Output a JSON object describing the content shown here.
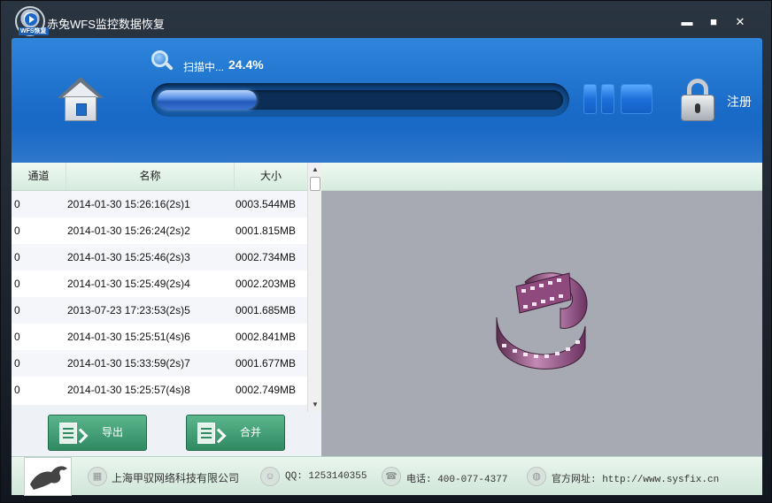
{
  "window": {
    "title": "赤兔WFS监控数据恢复",
    "logo_tag": "WFS恢复",
    "minimize": "▬",
    "maximize": "■",
    "close": "✕"
  },
  "header": {
    "scan_label": "扫描中...",
    "scan_percent": "24.4%",
    "progress": 0.244,
    "register_label": "注册"
  },
  "list": {
    "columns": [
      "通道",
      "名称",
      "大小"
    ],
    "rows": [
      {
        "channel": "0",
        "name": "2014-01-30 15:26:16(2s)1",
        "size": "0003.544MB"
      },
      {
        "channel": "0",
        "name": "2014-01-30 15:26:24(2s)2",
        "size": "0001.815MB"
      },
      {
        "channel": "0",
        "name": "2014-01-30 15:25:46(2s)3",
        "size": "0002.734MB"
      },
      {
        "channel": "0",
        "name": "2014-01-30 15:25:49(2s)4",
        "size": "0002.203MB"
      },
      {
        "channel": "0",
        "name": "2013-07-23 17:23:53(2s)5",
        "size": "0001.685MB"
      },
      {
        "channel": "0",
        "name": "2014-01-30 15:25:51(4s)6",
        "size": "0002.841MB"
      },
      {
        "channel": "0",
        "name": "2014-01-30 15:33:59(2s)7",
        "size": "0001.677MB"
      },
      {
        "channel": "0",
        "name": "2014-01-30 15:25:57(4s)8",
        "size": "0002.749MB"
      }
    ]
  },
  "actions": {
    "export_label": "导出",
    "merge_label": "合并"
  },
  "footer": {
    "company": "上海甲驭网络科技有限公司",
    "qq": "QQ: 1253140355",
    "phone": "电话: 400-077-4377",
    "website": "官方网址: http://www.sysfix.cn"
  },
  "colors": {
    "header_blue": "#1a6cc8",
    "button_green": "#2f8a62",
    "film_purple": "#8e4a7c"
  }
}
